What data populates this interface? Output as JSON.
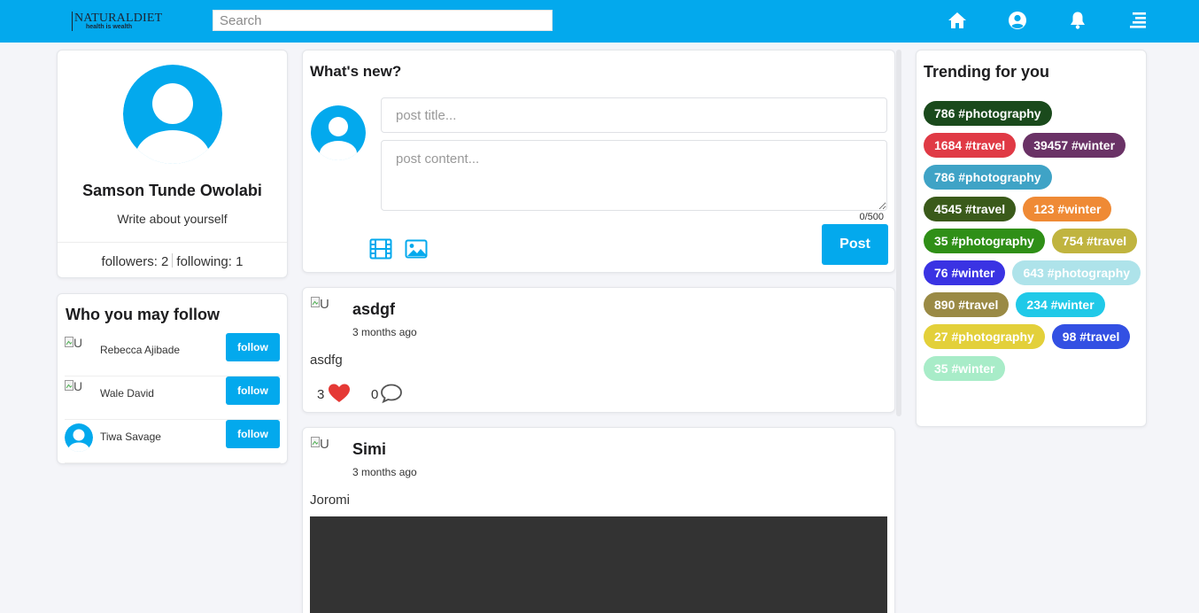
{
  "header": {
    "logo_text": "NATURALDIET",
    "logo_tagline": "health is wealth",
    "search_placeholder": "Search",
    "icons": [
      "home-icon",
      "user-circle-icon",
      "bell-icon",
      "menu-icon"
    ],
    "accent_color": "#03a9ed"
  },
  "profile": {
    "name": "Samson Tunde Owolabi",
    "bio": "Write about yourself",
    "followers": "followers: 2",
    "following": "following: 1"
  },
  "suggestions": {
    "title": "Who you may follow",
    "button_label": "follow",
    "people": [
      {
        "name": "Rebecca Ajibade",
        "avatar_alt": "U"
      },
      {
        "name": "Wale David",
        "avatar_alt": "U"
      },
      {
        "name": "Tiwa Savage",
        "avatar_alt": ""
      }
    ]
  },
  "composer": {
    "title": "What's new?",
    "title_placeholder": "post title...",
    "content_placeholder": "post content...",
    "counter": "0/500",
    "post_label": "Post"
  },
  "posts": [
    {
      "avatar_alt": "U",
      "author": "asdgf",
      "time": "3 months ago",
      "body": "asdfg",
      "likes": "3",
      "comments": "0"
    },
    {
      "avatar_alt": "U",
      "author": "Simi",
      "time": "3 months ago",
      "body": "Joromi"
    }
  ],
  "trending": {
    "title": "Trending for you",
    "tags": [
      {
        "label": "786 #photography",
        "color": "#1a4a1c"
      },
      {
        "label": "1684 #travel",
        "color": "#e03a45"
      },
      {
        "label": "39457 #winter",
        "color": "#6a3266"
      },
      {
        "label": "786 #photography",
        "color": "#3fa3c6"
      },
      {
        "label": "4545 #travel",
        "color": "#3a5a1a"
      },
      {
        "label": "123 #winter",
        "color": "#ef8a35"
      },
      {
        "label": "35 #photography",
        "color": "#2f8f17"
      },
      {
        "label": "754 #travel",
        "color": "#c0b43f"
      },
      {
        "label": "76 #winter",
        "color": "#3a33e3"
      },
      {
        "label": "643 #photography",
        "color": "#aee3ea"
      },
      {
        "label": "890 #travel",
        "color": "#9a8a45"
      },
      {
        "label": "234 #winter",
        "color": "#20c9e8"
      },
      {
        "label": "27 #photography",
        "color": "#e3d03a"
      },
      {
        "label": "98 #travel",
        "color": "#3350e3"
      },
      {
        "label": "35 #winter",
        "color": "#a8ecc8"
      }
    ]
  }
}
